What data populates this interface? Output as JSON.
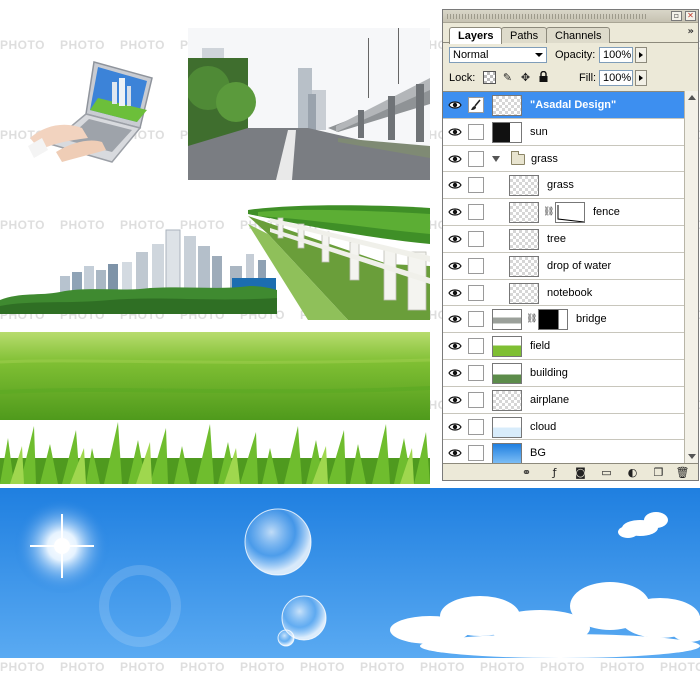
{
  "watermark": {
    "text": "PHOTO"
  },
  "collage": {
    "laptop": "laptop-photo",
    "road": "highway-photo",
    "city": "city-skyline-photo",
    "fence": "fence-hedge-photo",
    "field": "grass-field-photo",
    "grass": "grass-blades-photo",
    "sky": "blue-sky-photo"
  },
  "panel": {
    "tabs": [
      {
        "label": "Layers",
        "active": true
      },
      {
        "label": "Paths",
        "active": false
      },
      {
        "label": "Channels",
        "active": false
      }
    ],
    "blend_mode": "Normal",
    "opacity_label": "Opacity:",
    "opacity_value": "100%",
    "lock_label": "Lock:",
    "fill_label": "Fill:",
    "fill_value": "100%",
    "layers": [
      {
        "name": "\"Asadal Design\"",
        "selected": true,
        "visible": true,
        "indent": 0,
        "kind": "text"
      },
      {
        "name": "sun",
        "selected": false,
        "visible": true,
        "indent": 0,
        "kind": "pixel"
      },
      {
        "name": "grass",
        "selected": false,
        "visible": true,
        "indent": 0,
        "kind": "group"
      },
      {
        "name": "grass",
        "selected": false,
        "visible": true,
        "indent": 1,
        "kind": "pixel"
      },
      {
        "name": "fence",
        "selected": false,
        "visible": true,
        "indent": 1,
        "kind": "masked"
      },
      {
        "name": "tree",
        "selected": false,
        "visible": true,
        "indent": 1,
        "kind": "pixel"
      },
      {
        "name": "drop of water",
        "selected": false,
        "visible": true,
        "indent": 1,
        "kind": "pixel"
      },
      {
        "name": "notebook",
        "selected": false,
        "visible": true,
        "indent": 1,
        "kind": "pixel"
      },
      {
        "name": "bridge",
        "selected": false,
        "visible": true,
        "indent": 0,
        "kind": "masked"
      },
      {
        "name": "field",
        "selected": false,
        "visible": true,
        "indent": 0,
        "kind": "pixel"
      },
      {
        "name": "building",
        "selected": false,
        "visible": true,
        "indent": 0,
        "kind": "pixel"
      },
      {
        "name": "airplane",
        "selected": false,
        "visible": true,
        "indent": 0,
        "kind": "pixel"
      },
      {
        "name": "cloud",
        "selected": false,
        "visible": true,
        "indent": 0,
        "kind": "pixel"
      },
      {
        "name": "BG",
        "selected": false,
        "visible": true,
        "indent": 0,
        "kind": "pixel"
      }
    ],
    "bottom_icons": [
      "link-layers-icon",
      "layer-style-icon",
      "add-mask-icon",
      "new-group-icon",
      "adjustment-layer-icon",
      "new-layer-icon",
      "trash-icon"
    ]
  },
  "colors": {
    "selection": "#3d8ff0",
    "panel_bg": "#ece9d8",
    "sky": "#1f7fe0",
    "grass": "#6db62a"
  }
}
